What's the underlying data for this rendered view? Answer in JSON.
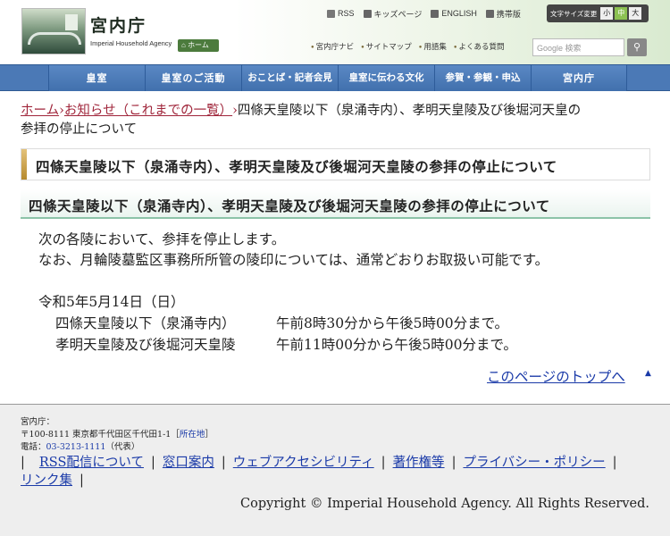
{
  "header": {
    "site_title": "宮内庁",
    "site_subtitle": "Imperial Household Agency",
    "home_label": "ホーム",
    "util_links": [
      "RSS",
      "キッズページ",
      "ENGLISH",
      "携帯版"
    ],
    "text_size_label": "文字サイズ変更",
    "text_sizes": [
      "小",
      "中",
      "大"
    ],
    "nav_links": [
      "宮内庁ナビ",
      "サイトマップ",
      "用語集",
      "よくある質問"
    ],
    "search_placeholder": "Google 検索"
  },
  "gnav": {
    "items": [
      "皇室",
      "皇室のご活動",
      "おことば・記者会見",
      "皇室に伝わる文化",
      "参賀・参観・申込",
      "宮内庁"
    ]
  },
  "breadcrumb": {
    "home": "ホーム",
    "news": "お知らせ（これまでの一覧）",
    "sep": "›",
    "current_line1": "四條天皇陵以下（泉涌寺内）、孝明天皇陵及び後堀河天皇の",
    "current_line2": "参拝の停止について"
  },
  "page": {
    "title": "四條天皇陵以下（泉涌寺内）、孝明天皇陵及び後堀河天皇陵の参拝の停止について",
    "sub_heading": "四條天皇陵以下（泉涌寺内）、孝明天皇陵及び後堀河天皇陵の参拝の停止について",
    "body_1": "次の各陵において、参拝を停止します。",
    "body_2": "なお、月輪陵墓監区事務所所管の陵印については、通常どおりお取扱い可能です。",
    "date": "令和5年5月14日（日）",
    "row1_name": "四條天皇陵以下（泉涌寺内）",
    "row1_time": "午前8時30分から午後5時00分まで。",
    "row2_name": "孝明天皇陵及び後堀河天皇陵",
    "row2_time": "午前11時00分から午後5時00分まで。",
    "top_link": "このページのトップへ"
  },
  "footer": {
    "org": "宮内庁：",
    "address": "〒100-8111 東京都千代田区千代田1-1",
    "address_link": "所在地",
    "tel_label": "電話：",
    "tel": "03-3213-1111",
    "tel_note": "（代表）",
    "links": [
      "RSS配信について",
      "窓口案内",
      "ウェブアクセシビリティ",
      "著作権等",
      "プライバシー・ポリシー",
      "リンク集"
    ],
    "copyright": "Copyright © Imperial Household Agency. All Rights Reserved."
  }
}
